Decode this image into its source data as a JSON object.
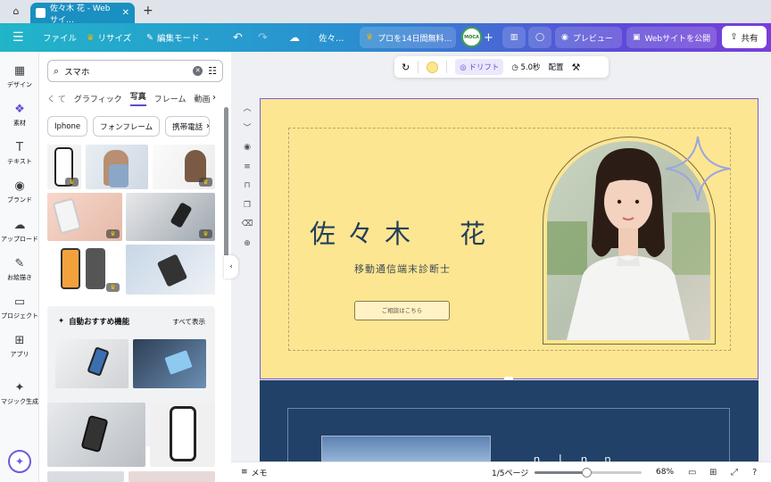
{
  "browser": {
    "tab_title": "佐々木 花 - Webサイ…",
    "close": "✕",
    "new_tab": "+"
  },
  "toolbar": {
    "menu": "☰",
    "file": "ファイル",
    "resize": "リサイズ",
    "edit_mode": "編集モード",
    "doc_name": "佐々…",
    "pro_trial": "プロを14日間無料…",
    "avatar_text": "MOCA",
    "plus": "+",
    "preview": "プレビュー",
    "publish": "Webサイトを公開",
    "share": "共有"
  },
  "rail": [
    {
      "label": "デザイン",
      "icon": "▦"
    },
    {
      "label": "素材",
      "icon": "❖"
    },
    {
      "label": "テキスト",
      "icon": "T"
    },
    {
      "label": "ブランド",
      "icon": "◉"
    },
    {
      "label": "アップロード",
      "icon": "☁"
    },
    {
      "label": "お絵描き",
      "icon": "✎"
    },
    {
      "label": "プロジェクト",
      "icon": "▭"
    },
    {
      "label": "アプリ",
      "icon": "⊞"
    },
    {
      "label": "マジック生成",
      "icon": "✦"
    }
  ],
  "panel": {
    "search_value": "スマホ",
    "categories": [
      "く て",
      "グラフィック",
      "写真",
      "フレーム",
      "動画"
    ],
    "chips": [
      "Iphone",
      "フォンフレーム",
      "携帯電話"
    ],
    "auto_title": "自動おすすめ機能",
    "see_all": "すべて表示"
  },
  "float_toolbar": {
    "drift": "ドリフト",
    "duration": "5.0秒",
    "arrange": "配置"
  },
  "page1": {
    "name": "佐々木　花",
    "subtitle": "移動通信端末診断士",
    "button": "ご相談はこちら"
  },
  "page2": {
    "heading": "ｎ ｌ ｎ ｎ"
  },
  "bottom": {
    "memo": "メモ",
    "pages": "1/5ページ",
    "zoom": "68%",
    "zoom_fraction": 0.48
  },
  "colors": {
    "accent": "#5b4bd9",
    "page1_bg": "#fde691",
    "page2_bg": "#214168",
    "name_color": "#243f5c"
  }
}
